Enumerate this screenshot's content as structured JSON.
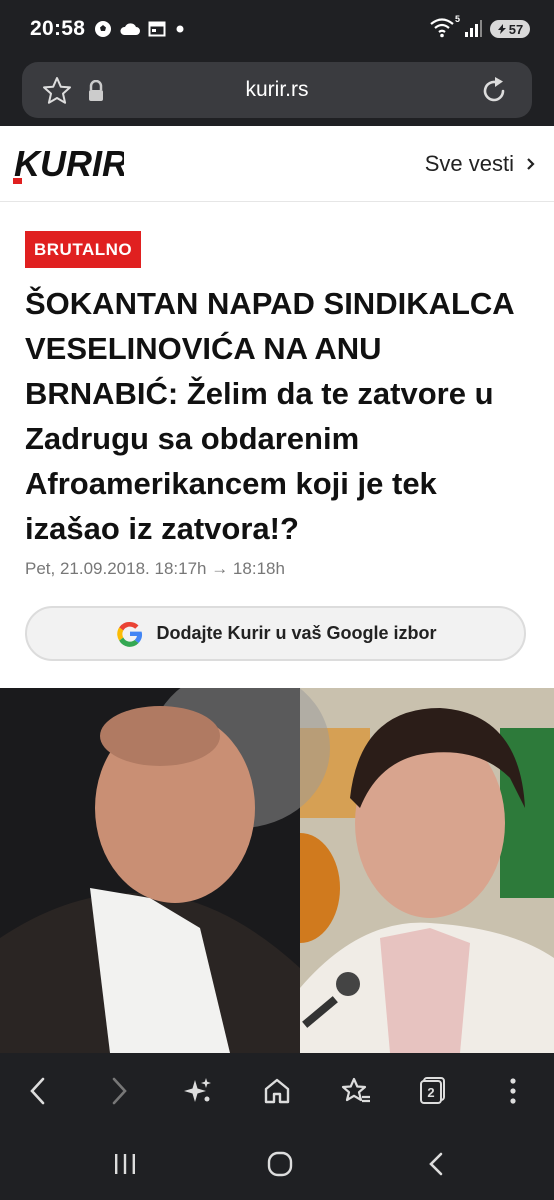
{
  "status_bar": {
    "time": "20:58",
    "icons": [
      "football-icon",
      "cloud-icon",
      "calendar-icon",
      "dot-icon"
    ],
    "right_icons": [
      "wifi-icon",
      "signal-icon"
    ],
    "wifi_label": "5",
    "battery": "57"
  },
  "browser": {
    "url": "kurir.rs",
    "icons": [
      "star-icon",
      "lock-icon",
      "reload-icon"
    ]
  },
  "site_header": {
    "logo_text": "KURIR",
    "sve_vesti": "Sve vesti",
    "brand_color": "#e02020"
  },
  "article": {
    "tag": "BRUTALNO",
    "headline": "ŠOKANTAN NAPAD SINDIKALCA VESELINOVIĆA NA ANU BRNABIĆ: Želim da te zatvore u Zadrugu sa obdarenim Afroamerikancem koji je tek izašao iz zatvora!?",
    "date": "Pet, 21.09.2018. 18:17h → 18:18h",
    "google_button": "Dodajte Kurir u vaš Google izbor"
  },
  "toolbar": {
    "items": [
      "back-icon",
      "forward-icon",
      "ai-sparkle-icon",
      "home-icon",
      "bookmarks-icon",
      "tabs-icon",
      "more-icon"
    ],
    "tab_count": "2"
  },
  "system_nav": {
    "items": [
      "recents-icon",
      "home-circle-icon",
      "back-triangle-icon"
    ]
  }
}
